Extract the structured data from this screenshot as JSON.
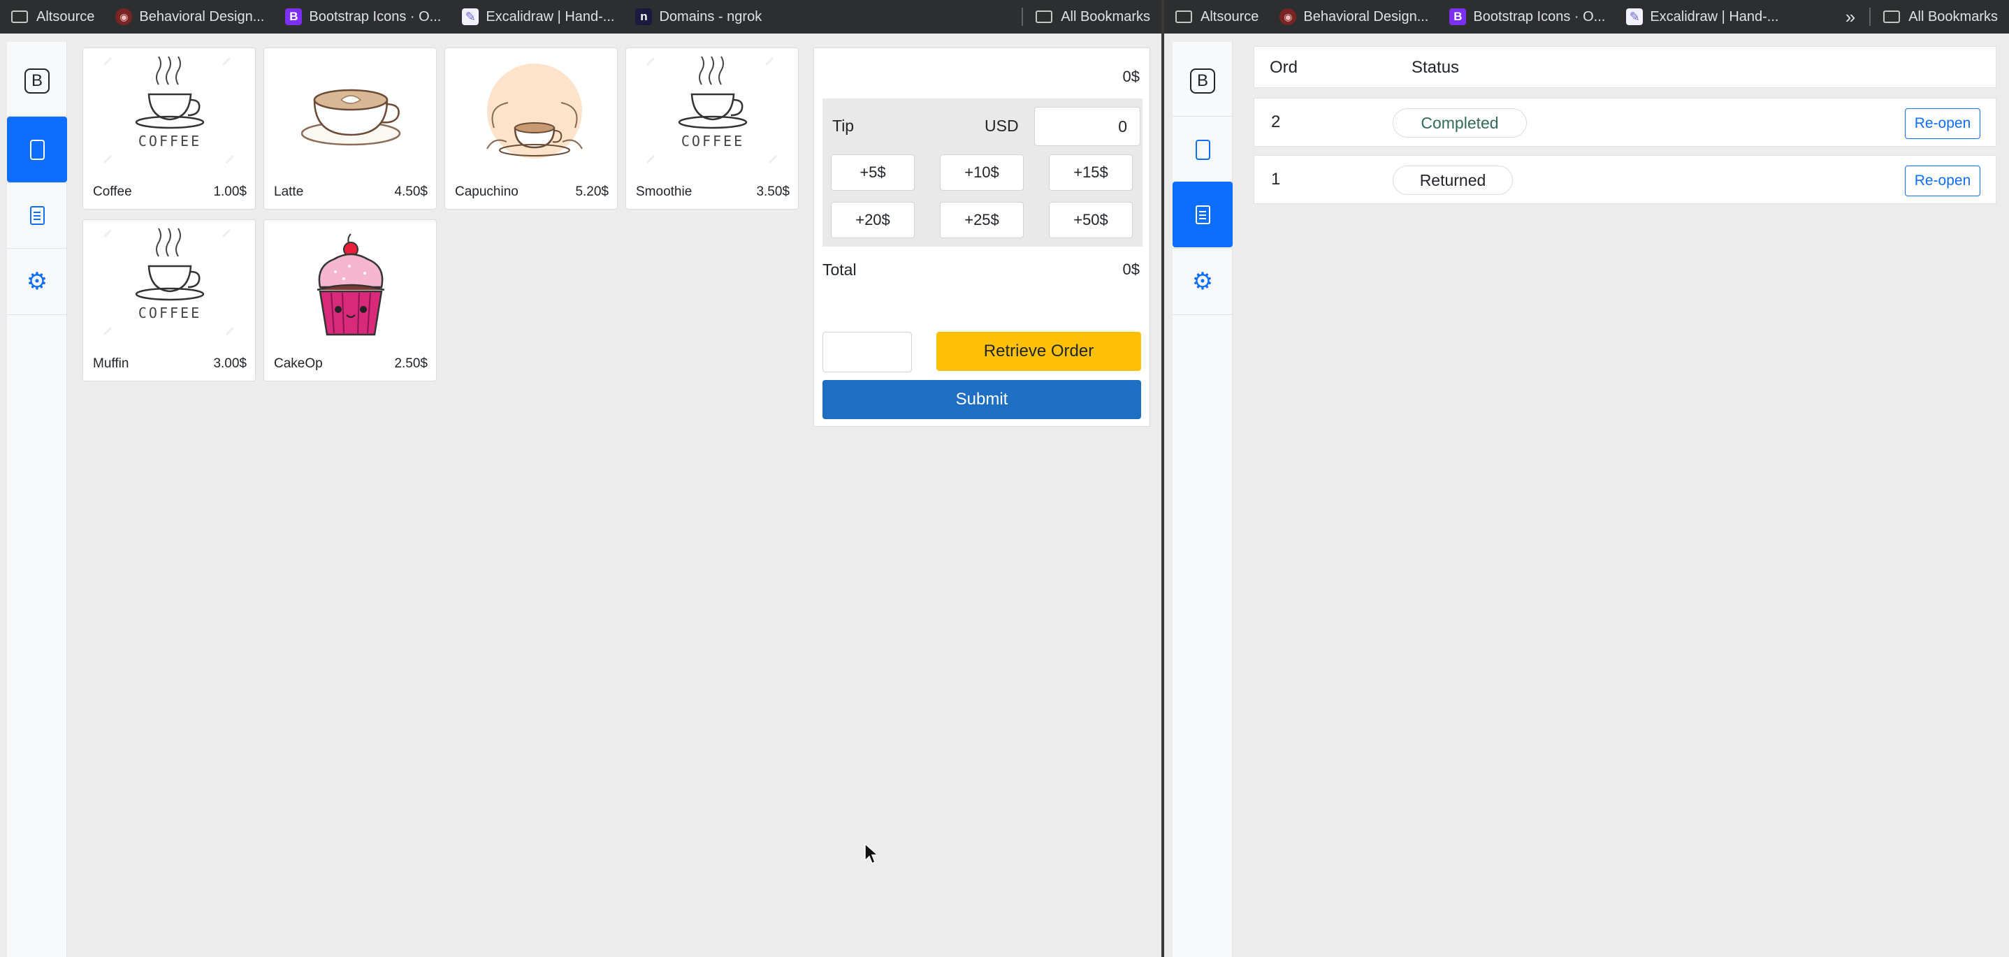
{
  "bookmarks_left": [
    {
      "label": "Altsource",
      "icon": "folder-icon"
    },
    {
      "label": "Behavioral Design...",
      "icon": "owl-favicon-icon"
    },
    {
      "label": "Bootstrap Icons · O...",
      "icon": "bootstrap-favicon-icon"
    },
    {
      "label": "Excalidraw | Hand-...",
      "icon": "excalidraw-favicon-icon"
    },
    {
      "label": "Domains - ngrok",
      "icon": "ngrok-favicon-icon"
    }
  ],
  "bookmarks_right": [
    {
      "label": "Altsource",
      "icon": "folder-icon"
    },
    {
      "label": "Behavioral Design...",
      "icon": "owl-favicon-icon"
    },
    {
      "label": "Bootstrap Icons · O...",
      "icon": "bootstrap-favicon-icon"
    },
    {
      "label": "Excalidraw | Hand-...",
      "icon": "excalidraw-favicon-icon"
    }
  ],
  "all_bookmarks": "All Bookmarks",
  "brand_letter": "B",
  "products": [
    {
      "name": "Coffee",
      "price": "1.00$",
      "image": "coffee-cup"
    },
    {
      "name": "Latte",
      "price": "4.50$",
      "image": "latte-cup"
    },
    {
      "name": "Capuchino",
      "price": "5.20$",
      "image": "capuchino-cup"
    },
    {
      "name": "Smoothie",
      "price": "3.50$",
      "image": "coffee-cup"
    },
    {
      "name": "Muffin",
      "price": "3.00$",
      "image": "coffee-cup"
    },
    {
      "name": "CakeOp",
      "price": "2.50$",
      "image": "cupcake"
    }
  ],
  "coffee_word": "COFFEE",
  "order": {
    "subtotal": "0$",
    "tip_label": "Tip",
    "currency": "USD",
    "tip_value": "0",
    "tip_buttons": [
      "+5$",
      "+10$",
      "+15$",
      "+20$",
      "+25$",
      "+50$"
    ],
    "total_label": "Total",
    "total_value": "0$",
    "retrieve_label": "Retrieve Order",
    "submit_label": "Submit"
  },
  "orders_table": {
    "headers": {
      "ord": "Ord",
      "status": "Status"
    },
    "rows": [
      {
        "id": "2",
        "status": "Completed",
        "action": "Re-open"
      },
      {
        "id": "1",
        "status": "Returned",
        "action": "Re-open"
      }
    ]
  },
  "colors": {
    "primary": "#0d6efd",
    "warning": "#ffc107",
    "submit": "#1e6ec4",
    "completed_text": "#316b54"
  }
}
